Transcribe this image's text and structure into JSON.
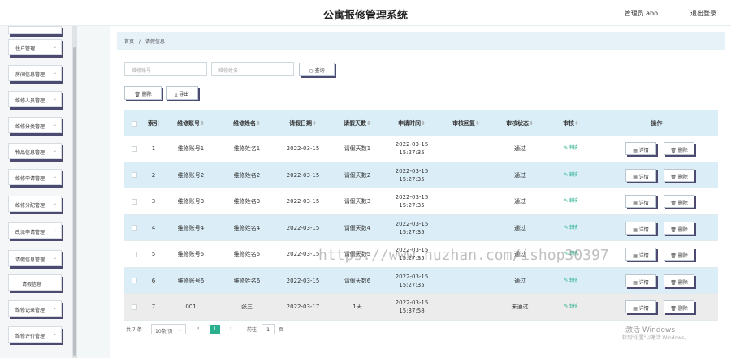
{
  "header": {
    "title": "公寓报修管理系统",
    "user": "管理员 abo",
    "logout": "退出登录"
  },
  "sidebar": [
    "住户管理",
    "房间信息管理",
    "维修人员管理",
    "维修分类管理",
    "物品信息管理",
    "维修申请管理",
    "维修分配管理",
    "改派申请管理",
    "请假信息管理",
    "请假信息",
    "维修记录管理",
    "维修评价管理"
  ],
  "breadcrumb": {
    "home": "首页",
    "sep": "/",
    "current": "请假信息"
  },
  "search": {
    "account_placeholder": "维修账号",
    "name_placeholder": "维修姓名",
    "button": "查询"
  },
  "toolbar": {
    "delete": "删除",
    "export": "导出"
  },
  "table": {
    "headers": [
      "索引",
      "维修账号",
      "维修姓名",
      "请假日期",
      "请假天数",
      "申请时间",
      "审核回复",
      "审核状态",
      "审核",
      "操作"
    ],
    "rows": [
      {
        "idx": "1",
        "account": "维修账号1",
        "name": "维修姓名1",
        "date": "2022-03-15",
        "days": "请假天数1",
        "time": "2022-03-15 15:27:35",
        "reply": "",
        "status": "通过",
        "audit": "审核"
      },
      {
        "idx": "2",
        "account": "维修账号2",
        "name": "维修姓名2",
        "date": "2022-03-15",
        "days": "请假天数2",
        "time": "2022-03-15 15:27:35",
        "reply": "",
        "status": "通过",
        "audit": "审核"
      },
      {
        "idx": "3",
        "account": "维修账号3",
        "name": "维修姓名3",
        "date": "2022-03-15",
        "days": "请假天数3",
        "time": "2022-03-15 15:27:35",
        "reply": "",
        "status": "通过",
        "audit": "审核"
      },
      {
        "idx": "4",
        "account": "维修账号4",
        "name": "维修姓名4",
        "date": "2022-03-15",
        "days": "请假天数4",
        "time": "2022-03-15 15:27:35",
        "reply": "",
        "status": "通过",
        "audit": "审核"
      },
      {
        "idx": "5",
        "account": "维修账号5",
        "name": "维修姓名5",
        "date": "2022-03-15",
        "days": "请假天数5",
        "time": "2022-03-15 15:27:35",
        "reply": "",
        "status": "通过",
        "audit": "审核"
      },
      {
        "idx": "6",
        "account": "维修账号6",
        "name": "维修姓名6",
        "date": "2022-03-15",
        "days": "请假天数6",
        "time": "2022-03-15 15:27:35",
        "reply": "",
        "status": "通过",
        "audit": "审核"
      },
      {
        "idx": "7",
        "account": "001",
        "name": "张三",
        "date": "2022-03-17",
        "days": "1天",
        "time": "2022-03-15 15:37:58",
        "reply": "",
        "status": "未通过",
        "audit": "审核"
      }
    ],
    "detail_label": "详情",
    "delete_label": "删除"
  },
  "pagination": {
    "total": "共 7 条",
    "page_size": "10条/页",
    "current": "1",
    "goto_prefix": "前往",
    "goto_value": "1",
    "goto_suffix": "页"
  },
  "watermark": "https://www.huzhan.com/ishop30397",
  "windows": {
    "line1": "激活 Windows",
    "line2": "转到\"设置\"以激活 Windows。"
  },
  "colors": {
    "accent": "#2bb08f",
    "row_stripe": "#dbeef8",
    "header_bg": "#daeef7"
  }
}
